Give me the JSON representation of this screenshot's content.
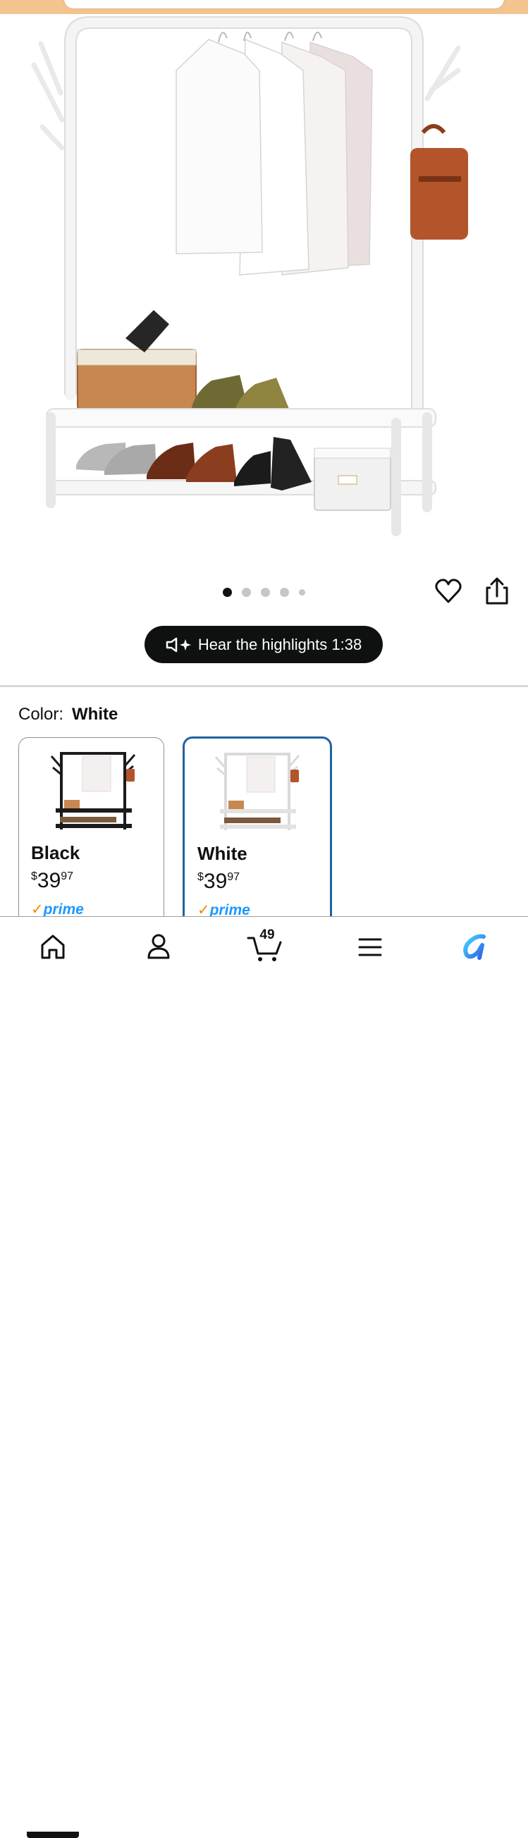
{
  "gallery": {
    "image_alt": "White clothing rack with hanging shirts, hooks, a bag and two shoe shelves",
    "dot_count": 5,
    "active_dot": 0
  },
  "actions": {
    "wishlist_icon": "heart-icon",
    "share_icon": "share-icon"
  },
  "audio": {
    "label": "Hear the highlights 1:38"
  },
  "variation": {
    "label": "Color:",
    "selected": "White",
    "options": [
      {
        "name": "Black",
        "price_symbol": "$",
        "price_whole": "39",
        "price_fraction": "97",
        "badge": "prime"
      },
      {
        "name": "White",
        "price_symbol": "$",
        "price_whole": "39",
        "price_fraction": "97",
        "badge": "prime"
      }
    ]
  },
  "nav": {
    "cart_count": "49",
    "items": [
      "home-icon",
      "account-icon",
      "cart-icon",
      "menu-icon",
      "rufus-icon"
    ]
  },
  "colors": {
    "top_bar": "#f3c48f",
    "selected_border": "#2162a1",
    "prime_blue": "#1a98ff",
    "prime_check": "#f08804"
  }
}
